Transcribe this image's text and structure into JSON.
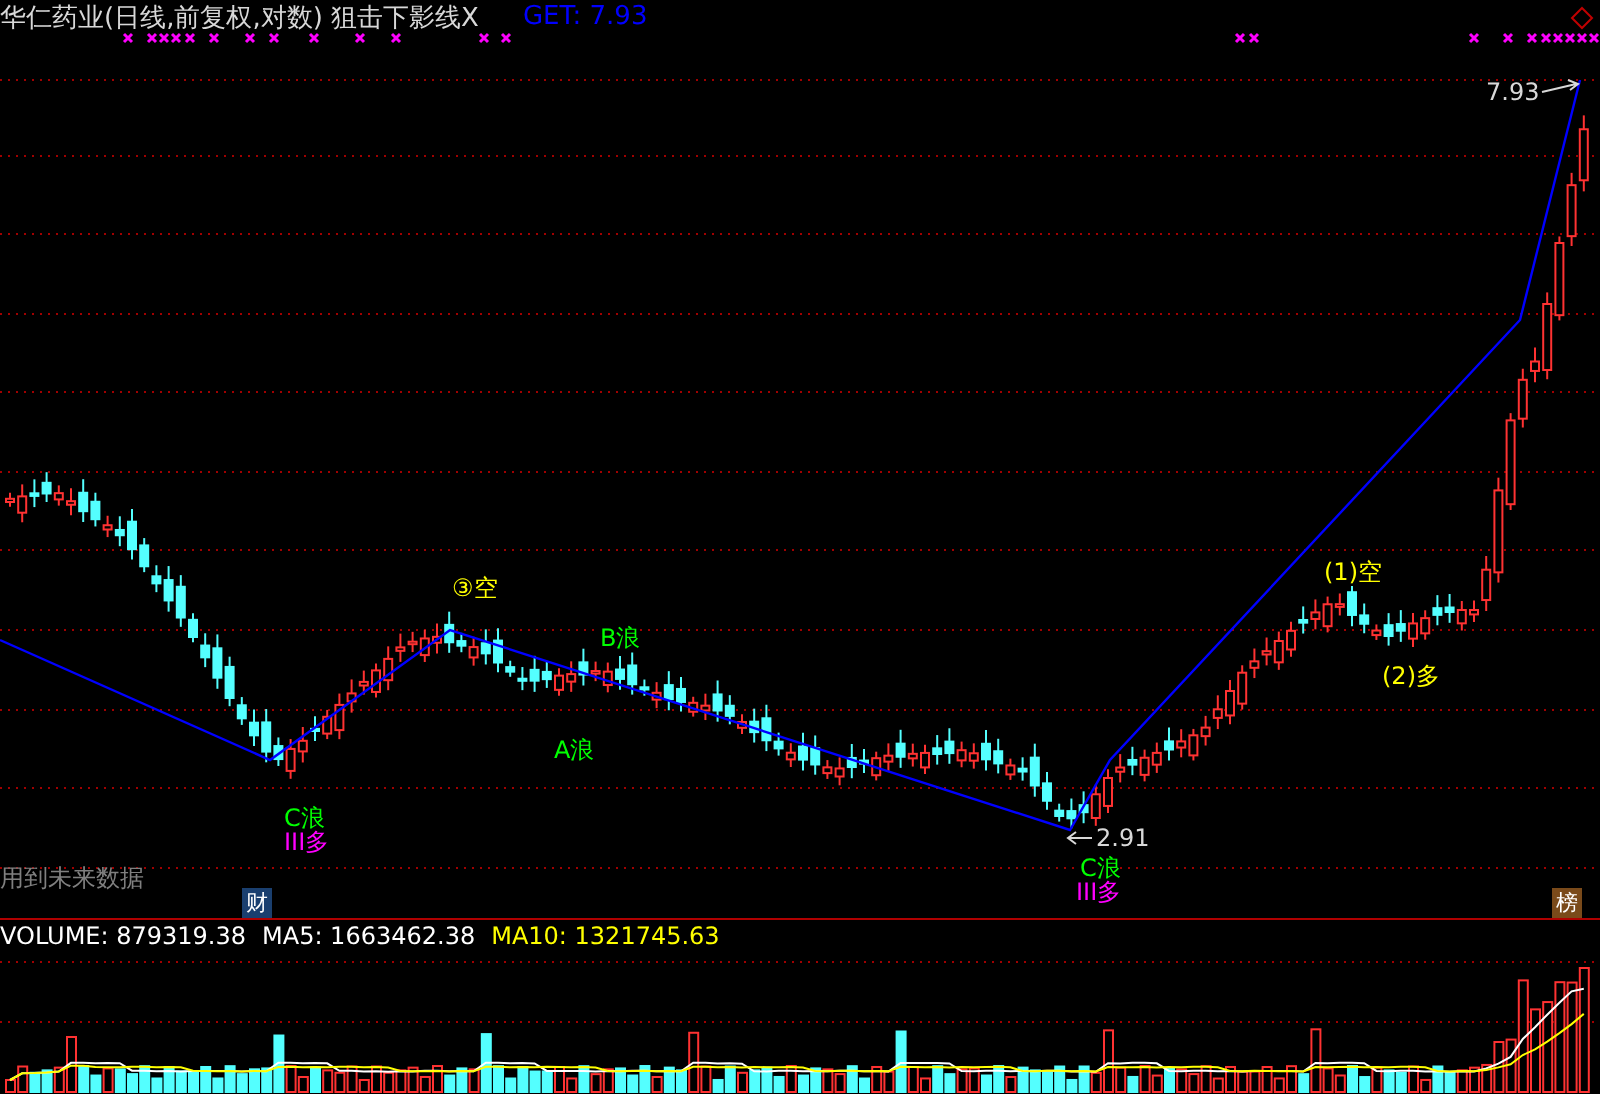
{
  "header": {
    "title": "华仁药业(日线,前复权,对数) 狙击下影线X",
    "indicator": "GET: 7.93"
  },
  "annotations": [
    {
      "text": "③空",
      "color": "#ffff00"
    },
    {
      "text": "B浪",
      "color": "#00ff00"
    },
    {
      "text": "A浪",
      "color": "#00ff00"
    },
    {
      "text": "C浪",
      "color": "#00ff00"
    },
    {
      "text": "III多",
      "color": "#ff00ff"
    },
    {
      "text": "C浪",
      "color": "#00ff00"
    },
    {
      "text": "III多",
      "color": "#ff00ff"
    },
    {
      "text": "(1)空",
      "color": "#ffff00"
    },
    {
      "text": "(2)多",
      "color": "#ffff00"
    }
  ],
  "price_marks": [
    {
      "text": "7.93"
    },
    {
      "text": "2.91"
    }
  ],
  "notice": "用到未来数据",
  "badges": [
    {
      "text": "财",
      "color": "#1a3f6f"
    },
    {
      "text": "榜",
      "color": "#7a4a1a"
    }
  ],
  "volume_legend": [
    {
      "label": "VOLUME: 879319.38",
      "color": "#ffffff"
    },
    {
      "label": "MA5: 1663462.38",
      "color": "#ffffff"
    },
    {
      "label": "MA10: 1321745.63",
      "color": "#ffff00"
    }
  ]
}
